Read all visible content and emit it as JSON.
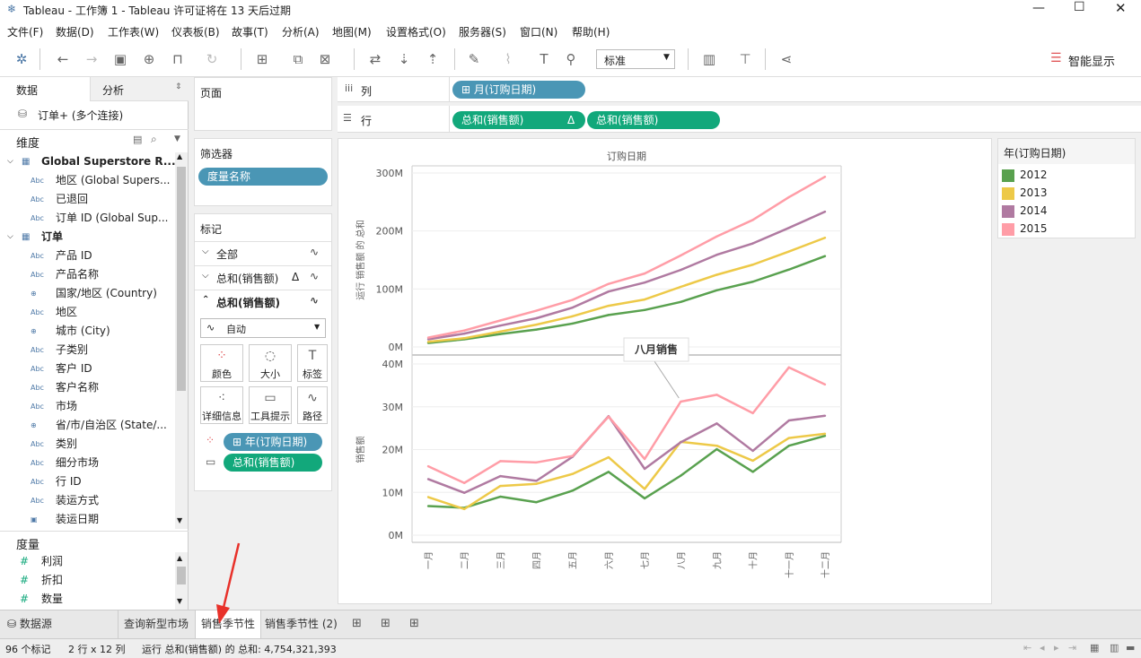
{
  "window": {
    "title": "Tableau - 工作簿 1 - Tableau 许可证将在 13 天后过期"
  },
  "menu": [
    "文件(F)",
    "数据(D)",
    "工作表(W)",
    "仪表板(B)",
    "故事(T)",
    "分析(A)",
    "地图(M)",
    "设置格式(O)",
    "服务器(S)",
    "窗口(N)",
    "帮助(H)"
  ],
  "toolbar": {
    "fit_select": "标准",
    "show_me": "智能显示"
  },
  "left": {
    "tab_data": "数据",
    "tab_analysis": "分析",
    "connection": "订单+ (多个连接)",
    "dimensions_header": "维度",
    "measures_header": "度量",
    "groups": [
      {
        "name": "Global Superstore R...",
        "fields": [
          {
            "type": "Abc",
            "name": "地区 (Global Supers..."
          },
          {
            "type": "Abc",
            "name": "已退回"
          },
          {
            "type": "Abc",
            "name": "订单 ID (Global Sup..."
          }
        ]
      },
      {
        "name": "订单",
        "fields": [
          {
            "type": "Abc",
            "name": "产品 ID"
          },
          {
            "type": "Abc",
            "name": "产品名称"
          },
          {
            "type": "globe",
            "name": "国家/地区 (Country)"
          },
          {
            "type": "Abc",
            "name": "地区"
          },
          {
            "type": "globe",
            "name": "城市 (City)"
          },
          {
            "type": "Abc",
            "name": "子类别"
          },
          {
            "type": "Abc",
            "name": "客户 ID"
          },
          {
            "type": "Abc",
            "name": "客户名称"
          },
          {
            "type": "Abc",
            "name": "市场"
          },
          {
            "type": "globe",
            "name": "省/市/自治区 (State/..."
          },
          {
            "type": "Abc",
            "name": "类别"
          },
          {
            "type": "Abc",
            "name": "细分市场"
          },
          {
            "type": "Abc",
            "name": "行 ID"
          },
          {
            "type": "Abc",
            "name": "装运方式"
          },
          {
            "type": "date",
            "name": "装运日期"
          }
        ]
      }
    ],
    "measures": [
      {
        "type": "#",
        "name": "利润"
      },
      {
        "type": "#",
        "name": "折扣"
      },
      {
        "type": "#",
        "name": "数量"
      }
    ]
  },
  "shelves": {
    "pages_label": "页面",
    "filters_label": "筛选器",
    "filter_pill": "度量名称",
    "marks_label": "标记",
    "marks_rows": [
      {
        "label": "全部",
        "delta": ""
      },
      {
        "label": "总和(销售额)",
        "delta": "Δ"
      },
      {
        "label": "总和(销售额)",
        "delta": ""
      }
    ],
    "mark_type": "自动",
    "mark_buttons": [
      "颜色",
      "大小",
      "标签",
      "详细信息",
      "工具提示",
      "路径"
    ],
    "color_pill": "年(订购日期)",
    "path_pill": "总和(销售额)",
    "columns_label": "列",
    "rows_label": "行",
    "columns_pill": "月(订购日期)",
    "rows_pills": [
      "总和(销售额)",
      "总和(销售额)"
    ],
    "rows_pill_delta": "Δ"
  },
  "legend": {
    "title": "年(订购日期)",
    "items": [
      {
        "label": "2012",
        "color": "#59a14f"
      },
      {
        "label": "2013",
        "color": "#edc948"
      },
      {
        "label": "2014",
        "color": "#b07aa1"
      },
      {
        "label": "2015",
        "color": "#ff9da7"
      }
    ]
  },
  "chart_data": [
    {
      "type": "line",
      "title": "订购日期",
      "ylabel": "运行 销售额 的 总和",
      "ylim": [
        0,
        300000000
      ],
      "yticks": [
        "0M",
        "100M",
        "200M",
        "300M"
      ],
      "categories": [
        "一月",
        "二月",
        "三月",
        "四月",
        "五月",
        "六月",
        "七月",
        "八月",
        "九月",
        "十月",
        "十一月",
        "十二月"
      ],
      "series": [
        {
          "name": "2012",
          "values": [
            6.8,
            13.2,
            22.2,
            29.9,
            40.3,
            55.1,
            63.7,
            77.6,
            97.7,
            112.5,
            133.4,
            156.6
          ]
        },
        {
          "name": "2013",
          "values": [
            8.9,
            15.0,
            26.5,
            38.5,
            52.8,
            71.0,
            81.8,
            103.6,
            124.5,
            141.9,
            164.6,
            188.3
          ]
        },
        {
          "name": "2014",
          "values": [
            13.1,
            23.0,
            36.8,
            49.5,
            67.8,
            95.6,
            111.1,
            132.8,
            158.9,
            178.6,
            205.4,
            233.3
          ]
        },
        {
          "name": "2015",
          "values": [
            16.1,
            28.3,
            45.6,
            62.6,
            81.1,
            108.8,
            126.6,
            157.8,
            190.6,
            219.1,
            258.3,
            293.5
          ]
        }
      ],
      "value_unit": "M"
    },
    {
      "type": "line",
      "ylabel": "销售额",
      "ylim": [
        0,
        40000000
      ],
      "yticks": [
        "0M",
        "10M",
        "20M",
        "30M",
        "40M"
      ],
      "categories": [
        "一月",
        "二月",
        "三月",
        "四月",
        "五月",
        "六月",
        "七月",
        "八月",
        "九月",
        "十月",
        "十一月",
        "十二月"
      ],
      "annotation": {
        "text": "八月销售",
        "category": "八月",
        "series": "2015"
      },
      "series": [
        {
          "name": "2012",
          "values": [
            6.8,
            6.4,
            9.0,
            7.7,
            10.4,
            14.8,
            8.6,
            13.9,
            20.1,
            14.8,
            20.9,
            23.2
          ]
        },
        {
          "name": "2013",
          "values": [
            8.9,
            6.1,
            11.5,
            12.0,
            14.3,
            18.2,
            10.8,
            21.8,
            20.9,
            17.4,
            22.7,
            23.7
          ]
        },
        {
          "name": "2014",
          "values": [
            13.1,
            9.9,
            13.8,
            12.7,
            18.3,
            27.8,
            15.5,
            21.7,
            26.1,
            19.7,
            26.8,
            27.9
          ]
        },
        {
          "name": "2015",
          "values": [
            16.1,
            12.2,
            17.3,
            17.0,
            18.5,
            27.7,
            17.8,
            31.2,
            32.8,
            28.5,
            39.2,
            35.2
          ]
        }
      ],
      "value_unit": "M"
    }
  ],
  "bottom": {
    "datasource": "数据源",
    "tabs": [
      "查询新型市场",
      "销售季节性",
      "销售季节性 (2)"
    ]
  },
  "status": {
    "marks": "96 个标记",
    "dims": "2 行 x 12 列",
    "sum": "运行 总和(销售额) 的 总和: 4,754,321,393"
  }
}
